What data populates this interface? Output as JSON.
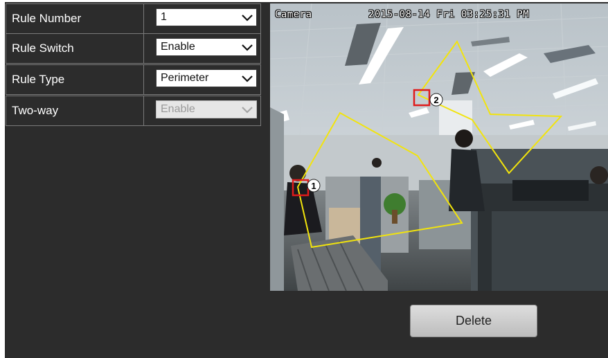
{
  "settings": {
    "rule_number": {
      "label": "Rule Number",
      "value": "1",
      "enabled": true
    },
    "rule_switch": {
      "label": "Rule Switch",
      "value": "Enable",
      "enabled": true
    },
    "rule_type": {
      "label": "Rule Type",
      "value": "Perimeter",
      "enabled": true
    },
    "two_way": {
      "label": "Two-way",
      "value": "Enable",
      "enabled": false
    }
  },
  "camera": {
    "name": "Camera",
    "datetime": "2015-08-14 Fri 03:25:31 PM",
    "rule_colors": {
      "line": "#f2e40c",
      "marker": "#e01b1b"
    },
    "rules": [
      {
        "id": "1",
        "label": "1"
      },
      {
        "id": "2",
        "label": "2"
      }
    ]
  },
  "actions": {
    "delete_label": "Delete"
  }
}
